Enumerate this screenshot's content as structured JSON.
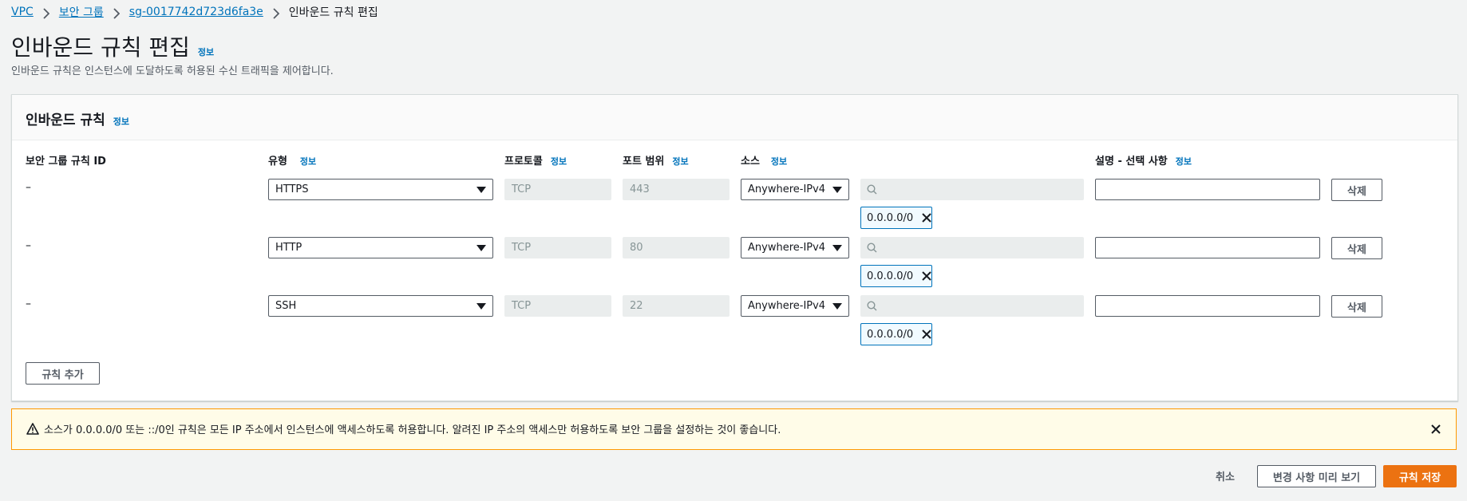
{
  "breadcrumb": {
    "items": [
      "VPC",
      "보안 그룹",
      "sg-0017742d723d6fa3e"
    ],
    "current": "인바운드 규칙 편집"
  },
  "page": {
    "title": "인바운드 규칙 편집",
    "info": "정보",
    "subtitle": "인바운드 규칙은 인스턴스에 도달하도록 허용된 수신 트래픽을 제어합니다."
  },
  "panel": {
    "title": "인바운드 규칙",
    "info": "정보",
    "columns": {
      "rule_id": "보안 그룹 규칙 ID",
      "type": "유형",
      "protocol": "프로토콜",
      "port_range": "포트 범위",
      "source": "소스",
      "description": "설명 - 선택 사항"
    },
    "column_info": "정보",
    "rows": [
      {
        "rule_id": "–",
        "type": "HTTPS",
        "protocol": "TCP",
        "port": "443",
        "source": "Anywhere-IPv4",
        "cidr": "0.0.0.0/0",
        "description": "",
        "delete": "삭제"
      },
      {
        "rule_id": "–",
        "type": "HTTP",
        "protocol": "TCP",
        "port": "80",
        "source": "Anywhere-IPv4",
        "cidr": "0.0.0.0/0",
        "description": "",
        "delete": "삭제"
      },
      {
        "rule_id": "–",
        "type": "SSH",
        "protocol": "TCP",
        "port": "22",
        "source": "Anywhere-IPv4",
        "cidr": "0.0.0.0/0",
        "description": "",
        "delete": "삭제"
      }
    ],
    "add_rule": "규칙 추가"
  },
  "alert": {
    "text": "소스가 0.0.0.0/0 또는 ::/0인 규칙은 모든 IP 주소에서 인스턴스에 액세스하도록 허용합니다. 알려진 IP 주소의 액세스만 허용하도록 보안 그룹을 설정하는 것이 좋습니다."
  },
  "footer": {
    "cancel": "취소",
    "preview": "변경 사항 미리 보기",
    "save": "규칙 저장"
  },
  "colors": {
    "link": "#0073bb",
    "primary": "#ec7211",
    "warning_border": "#ff9900",
    "warning_bg": "#fffce8"
  }
}
